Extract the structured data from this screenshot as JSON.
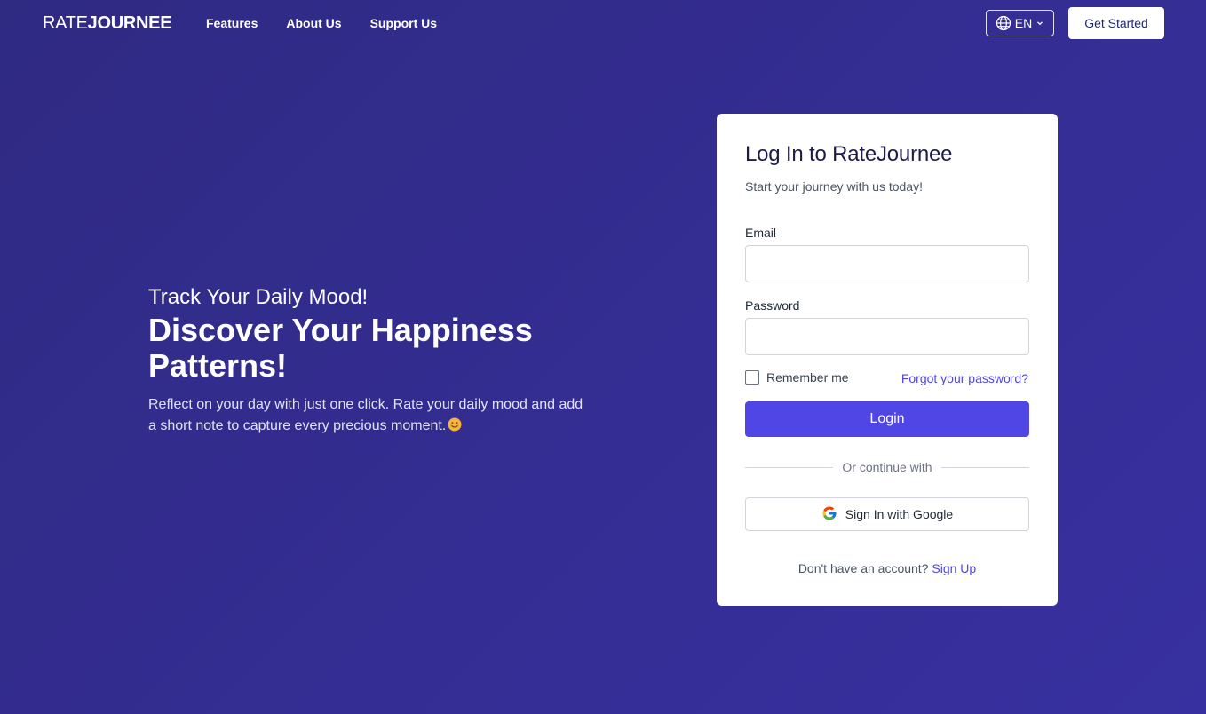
{
  "header": {
    "logo_light": "RATE",
    "logo_bold": "JOURNEE",
    "nav": [
      {
        "label": "Features"
      },
      {
        "label": "About Us"
      },
      {
        "label": "Support Us"
      }
    ],
    "language": "EN",
    "language_icon": "globe-icon",
    "get_started": "Get Started"
  },
  "hero": {
    "subtitle": "Track Your Daily Mood!",
    "title": "Discover Your Happiness Patterns!",
    "description": "Reflect on your day with just one click. Rate your daily mood and add a short note to capture every precious moment.",
    "emoji_icon": "smiley-face-icon"
  },
  "login": {
    "title": "Log In to RateJournee",
    "subtitle": "Start your journey with us today!",
    "email_label": "Email",
    "email_value": "",
    "password_label": "Password",
    "password_value": "",
    "remember_label": "Remember me",
    "remember_checked": false,
    "forgot_label": "Forgot your password?",
    "login_button": "Login",
    "divider_text": "Or continue with",
    "google_button": "Sign In with Google",
    "google_icon": "google-icon",
    "no_account_text": "Don't have an account?",
    "signup_link": "Sign Up"
  },
  "colors": {
    "background": "#342d92",
    "accent": "#4f46e5",
    "card": "#ffffff"
  }
}
